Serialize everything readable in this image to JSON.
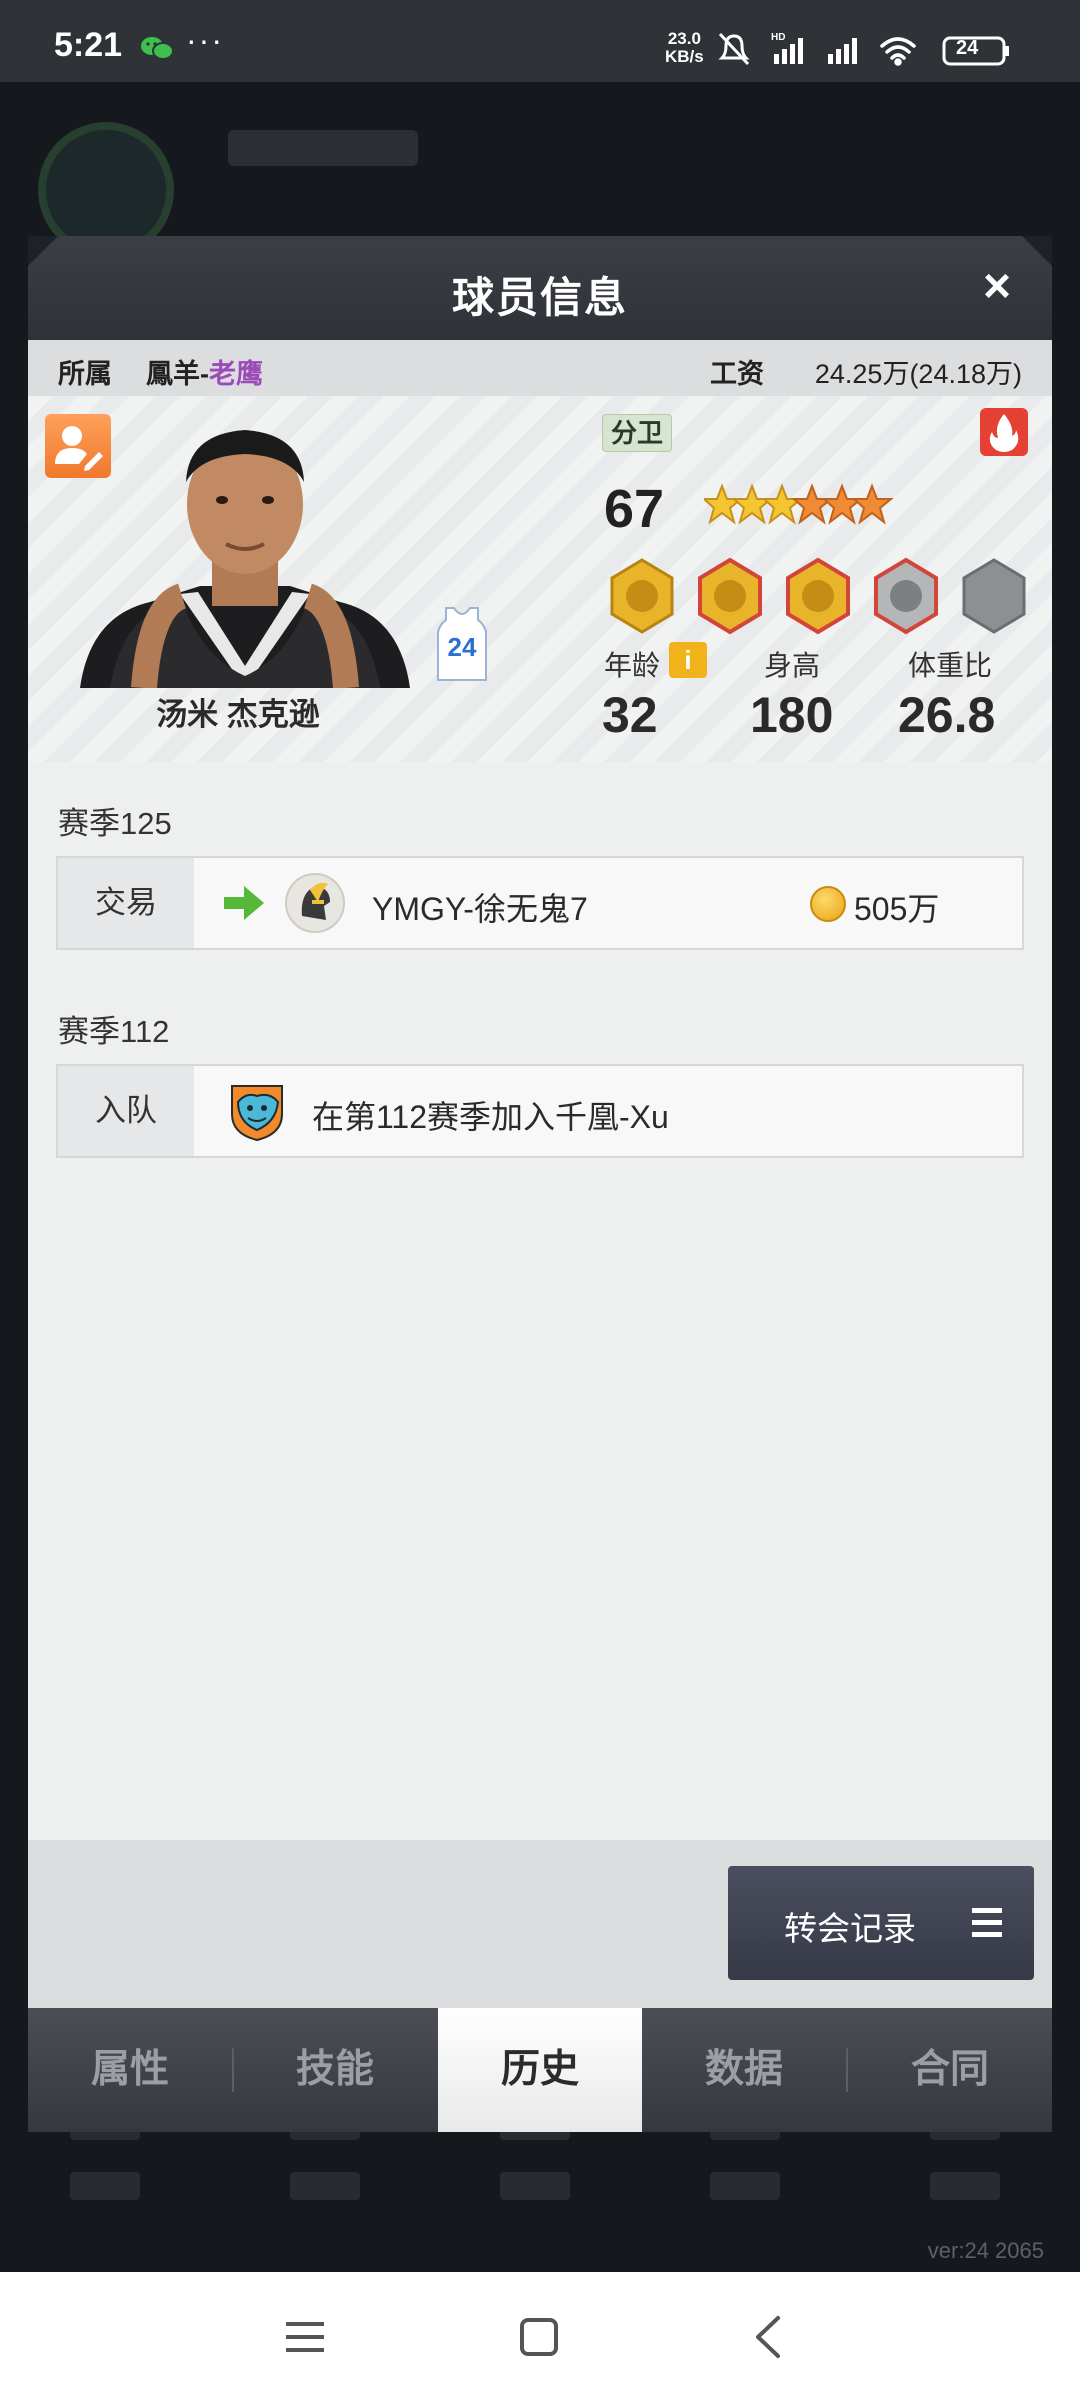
{
  "status_bar": {
    "time": "5:21",
    "dots": "···",
    "net_speed_value": "23.0",
    "net_speed_unit": "KB/s",
    "battery": "24",
    "icons": [
      "wechat-icon",
      "mute-icon",
      "hd-signal-icon",
      "signal-icon",
      "wifi-icon",
      "battery-icon"
    ]
  },
  "background": {
    "version": "ver:24  2065"
  },
  "modal": {
    "title": "球员信息",
    "close_icon": "×"
  },
  "team_bar": {
    "team_label": "所属",
    "team_name_prefix": "鳳羊-",
    "team_name_accent": "老鹰",
    "salary_label": "工资",
    "salary_value": "24.25万(24.18万)"
  },
  "player": {
    "name": "汤米 杰克逊",
    "jersey_number": "24",
    "position": "分卫",
    "rating": "67",
    "stars": 5,
    "stats": {
      "age_label": "年龄",
      "age": "32",
      "height_label": "身高",
      "height": "180",
      "weight_ratio_label": "体重比",
      "weight_ratio": "26.8"
    },
    "info_icon": "i"
  },
  "history": [
    {
      "season": "赛季125",
      "type": "交易",
      "team": "YMGY-徐无鬼7",
      "price": "505万"
    },
    {
      "season": "赛季112",
      "type": "入队",
      "text": "在第112赛季加入千凰-Xu"
    }
  ],
  "transfer_button": {
    "label": "转会记录"
  },
  "tabs": [
    {
      "label": "属性"
    },
    {
      "label": "技能"
    },
    {
      "label": "历史"
    },
    {
      "label": "数据"
    },
    {
      "label": "合同"
    }
  ],
  "colors": {
    "accent_purple": "#9a4bb8",
    "edit_orange": "#f1782d",
    "fire_red": "#e44034",
    "arrow_green": "#55b838",
    "coin_gold": "#e7a414"
  }
}
